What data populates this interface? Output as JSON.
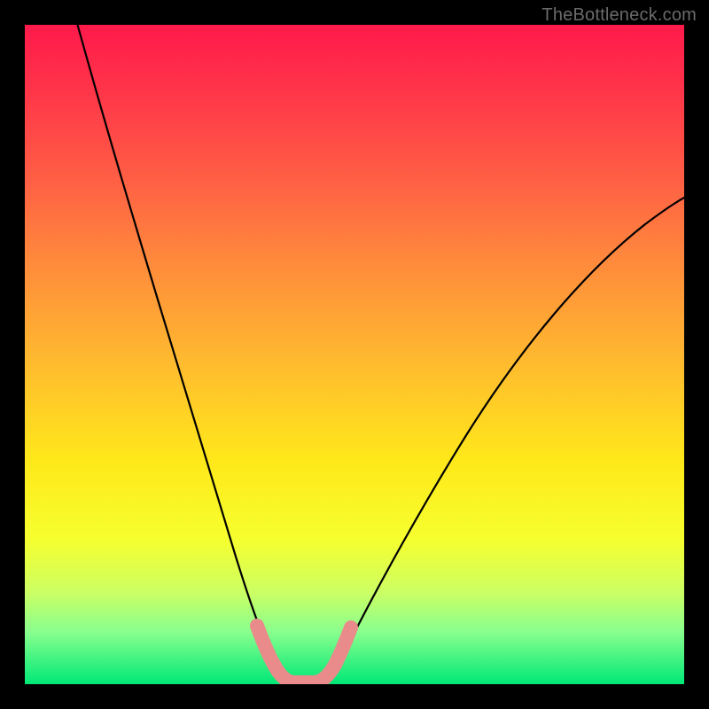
{
  "watermark": {
    "text": "TheBottleneck.com"
  },
  "chart_data": {
    "type": "line",
    "title": "",
    "xlabel": "",
    "ylabel": "",
    "xlim": [
      0,
      100
    ],
    "ylim": [
      0,
      100
    ],
    "series": [
      {
        "name": "bottleneck-curve",
        "x": [
          8,
          12,
          16,
          20,
          24,
          28,
          32,
          34,
          36,
          38,
          40,
          42,
          44,
          46,
          50,
          56,
          62,
          68,
          74,
          80,
          86,
          92,
          98,
          100
        ],
        "values": [
          100,
          86,
          73,
          61,
          49,
          37,
          24,
          15,
          8,
          3,
          0,
          0,
          0,
          3,
          9,
          18,
          27,
          35,
          43,
          50,
          57,
          63,
          68,
          70
        ]
      }
    ],
    "highlight": {
      "name": "optimum-band",
      "color": "#e98b8b",
      "x_range": [
        32,
        46
      ]
    },
    "grid": false,
    "legend": false
  },
  "colors": {
    "curve": "#000000",
    "highlight": "#e98b8b",
    "background_top": "#ff1a4b",
    "background_bottom": "#00e876",
    "frame": "#000000"
  }
}
